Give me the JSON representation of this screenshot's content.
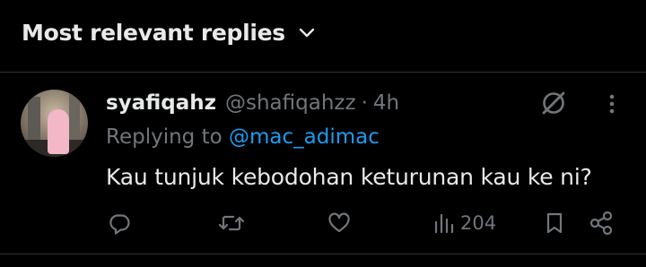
{
  "header": {
    "sort_label": "Most relevant replies"
  },
  "reply": {
    "display_name": "syafiqahz",
    "handle": "@shafiqahzz",
    "separator": "·",
    "time": "4h",
    "replying_prefix": "Replying to",
    "replying_to": "@mac_adimac",
    "text": "Kau tunjuk kebodohan keturunan kau ke ni?",
    "views": "204"
  },
  "icons": {
    "sort": "chevron-down-icon",
    "grok": "grok-icon",
    "more": "more-vertical-icon",
    "reply": "reply-icon",
    "retweet": "retweet-icon",
    "like": "heart-icon",
    "views": "views-chart-icon",
    "bookmark": "bookmark-icon",
    "share": "share-icon"
  },
  "colors": {
    "background": "#000000",
    "text_primary": "#e7e9ea",
    "text_secondary": "#71767b",
    "link": "#1d9bf0",
    "divider": "#2f3336"
  }
}
